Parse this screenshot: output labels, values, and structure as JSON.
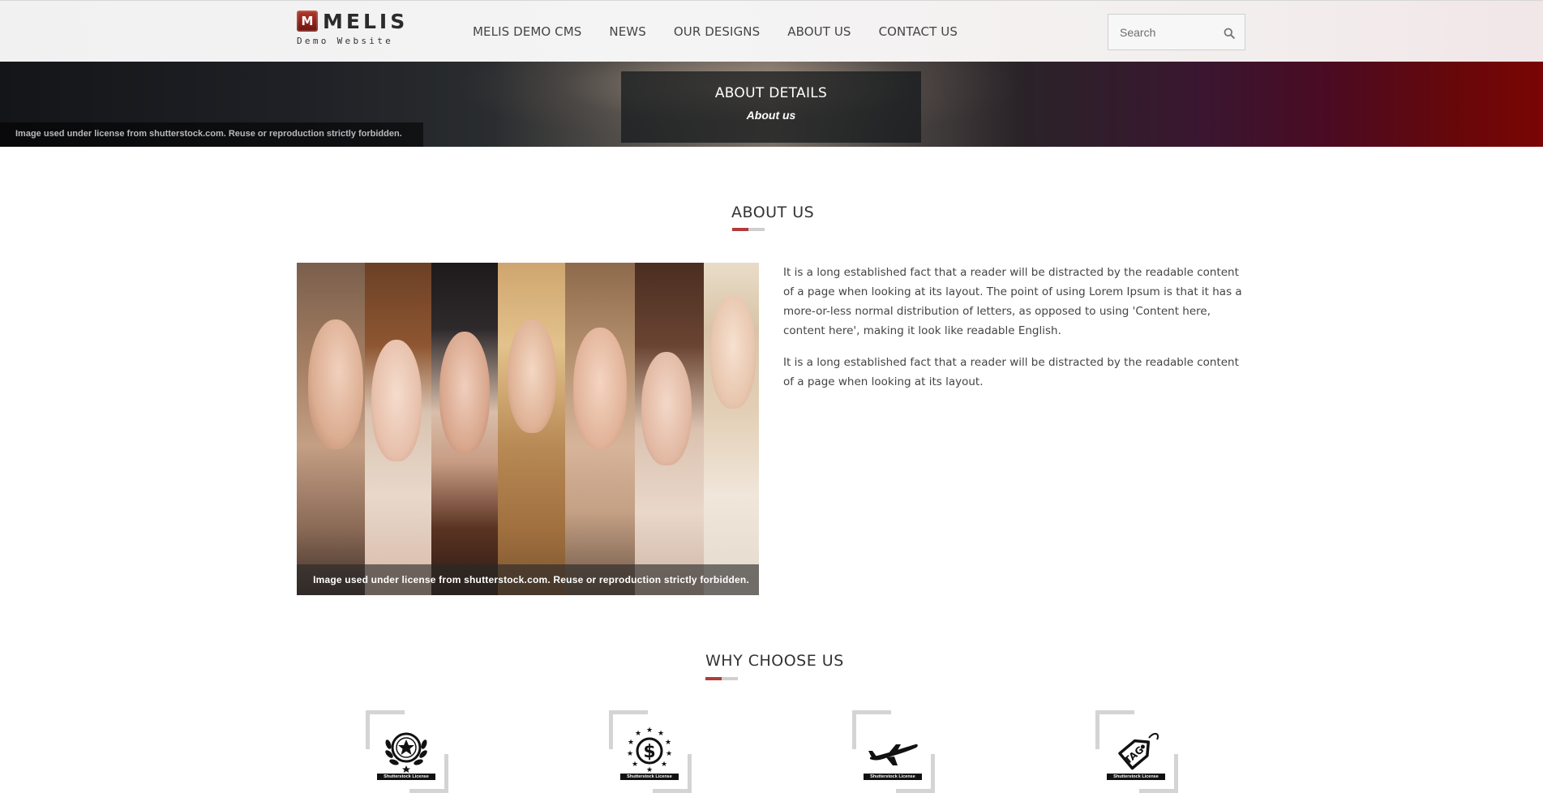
{
  "header": {
    "logo_letter": "M",
    "logo_word": "MELIS",
    "logo_sub": "Demo Website",
    "nav": [
      "MELIS DEMO CMS",
      "NEWS",
      "OUR DESIGNS",
      "ABOUT US",
      "CONTACT US"
    ],
    "search_placeholder": "Search"
  },
  "banner": {
    "title": "ABOUT DETAILS",
    "subtitle": "About us",
    "license": "Image used under license from shutterstock.com. Reuse or reproduction strictly forbidden."
  },
  "about": {
    "title": "ABOUT US",
    "image_license": "Image used under license from shutterstock.com. Reuse or reproduction strictly forbidden.",
    "paragraphs": [
      "It is a long established fact that a reader will be distracted by the readable content of a page when looking at its layout. The point of using Lorem Ipsum is that it has a more-or-less normal distribution of letters, as opposed to using 'Content here, content here', making it look like readable English.",
      "It is a long established fact that a reader will be distracted by the readable content of a page when looking at its layout."
    ]
  },
  "why": {
    "title": "WHY CHOOSE US",
    "features": [
      {
        "icon": "laurel-star-icon",
        "stamp": "Shutterstock License"
      },
      {
        "icon": "dollar-stars-icon",
        "stamp": "Shutterstock License"
      },
      {
        "icon": "airplane-icon",
        "stamp": "Shutterstock License"
      },
      {
        "icon": "tag-icon",
        "stamp": "Shutterstock License",
        "tag_text": "TAG"
      }
    ]
  },
  "colors": {
    "accent_red": "#b23a3a",
    "divider_grey": "#cfcfcf",
    "logo_red": "#8a1f16"
  }
}
